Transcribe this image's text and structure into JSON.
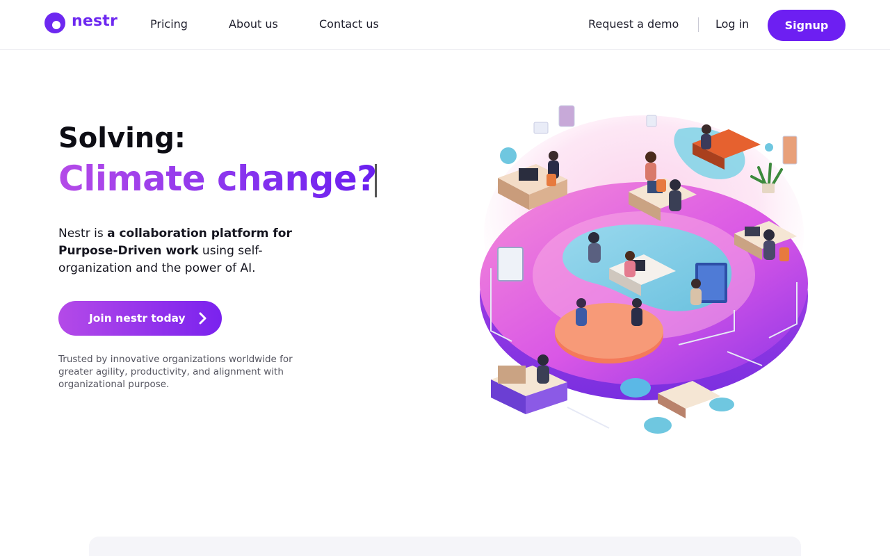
{
  "nav": {
    "logo_text": "nestr",
    "links": [
      "Pricing",
      "About us",
      "Contact us"
    ],
    "request_demo": "Request a demo",
    "login": "Log in",
    "signup": "Signup"
  },
  "hero": {
    "solving_label": "Solving:",
    "rotating_text": "Climate change?",
    "description": {
      "part1": "Nestr is ",
      "bold1": "a collaboration platform for Purpose-Driven work",
      "part2": " using self-organization and the power of AI."
    },
    "cta_label": "Join nestr today",
    "trusted_text": "Trusted by innovative organizations worldwide for greater agility, productivity, and alignment with organizational purpose."
  },
  "colors": {
    "brand_purple": "#6d1ff2",
    "gradient_start": "#b44ae8",
    "gradient_end": "#6a1ff0"
  },
  "icons": {
    "cta": "chevron-right-icon",
    "logo": "nestr-logo-mark-icon"
  }
}
